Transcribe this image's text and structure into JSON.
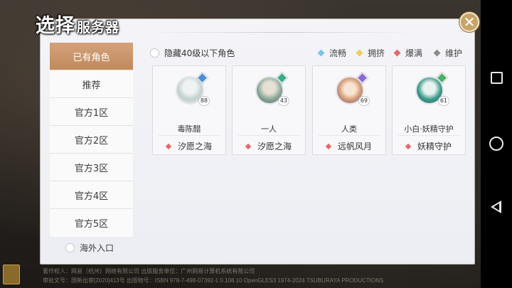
{
  "title": {
    "big": "选择",
    "small": "服务器"
  },
  "sidebar": {
    "items": [
      {
        "label": "已有角色",
        "active": true
      },
      {
        "label": "推荐",
        "active": false
      },
      {
        "label": "官方1区",
        "active": false
      },
      {
        "label": "官方2区",
        "active": false
      },
      {
        "label": "官方3区",
        "active": false
      },
      {
        "label": "官方4区",
        "active": false
      },
      {
        "label": "官方5区",
        "active": false
      }
    ],
    "overseas_label": "海外入口"
  },
  "filter": {
    "hide_low_level_label": "隐藏40级以下角色"
  },
  "legend": [
    {
      "label": "流畅",
      "color": "#7ec3e8"
    },
    {
      "label": "拥挤",
      "color": "#f0cf5a"
    },
    {
      "label": "爆满",
      "color": "#e46a6a"
    },
    {
      "label": "维护",
      "color": "#8c8c8c"
    }
  ],
  "roles": [
    {
      "name": "毒陈醋",
      "level": "88",
      "server": "汐愿之海",
      "status_color": "#e46a6a",
      "class_color": "#4a8fd0",
      "avatar_colors": [
        "#eef2f2",
        "#bfd0cc"
      ]
    },
    {
      "name": "一人",
      "level": "43",
      "server": "汐愿之海",
      "status_color": "#e46a6a",
      "class_color": "#3aaa8a",
      "avatar_colors": [
        "#dfe8e0",
        "#8aa898"
      ]
    },
    {
      "name": "人类",
      "level": "69",
      "server": "远帆风月",
      "status_color": "#e46a6a",
      "class_color": "#8a6ad0",
      "avatar_colors": [
        "#f4dcc8",
        "#c8846a"
      ]
    },
    {
      "name": "小白·妖精守护",
      "level": "61",
      "server": "妖精守护",
      "status_color": "#e46a6a",
      "class_color": "#4ab06a",
      "avatar_colors": [
        "#d8ece6",
        "#3a9a8a"
      ]
    }
  ],
  "icons": {
    "close": "close-icon",
    "radio": "radio-circle",
    "status": "diamond-icon"
  },
  "footer": {
    "line1": "著作权人：网易（杭州）网络有限公司 出版服务单位：广州网易计算机系统有限公司",
    "line2": "审批文号：国新出审[2020]413号 出版物号：ISBN 978-7-498-07392-1  0.108.10 OpenGLES3  1974-2024 TSUBURAYA PRODUCTIONS"
  }
}
